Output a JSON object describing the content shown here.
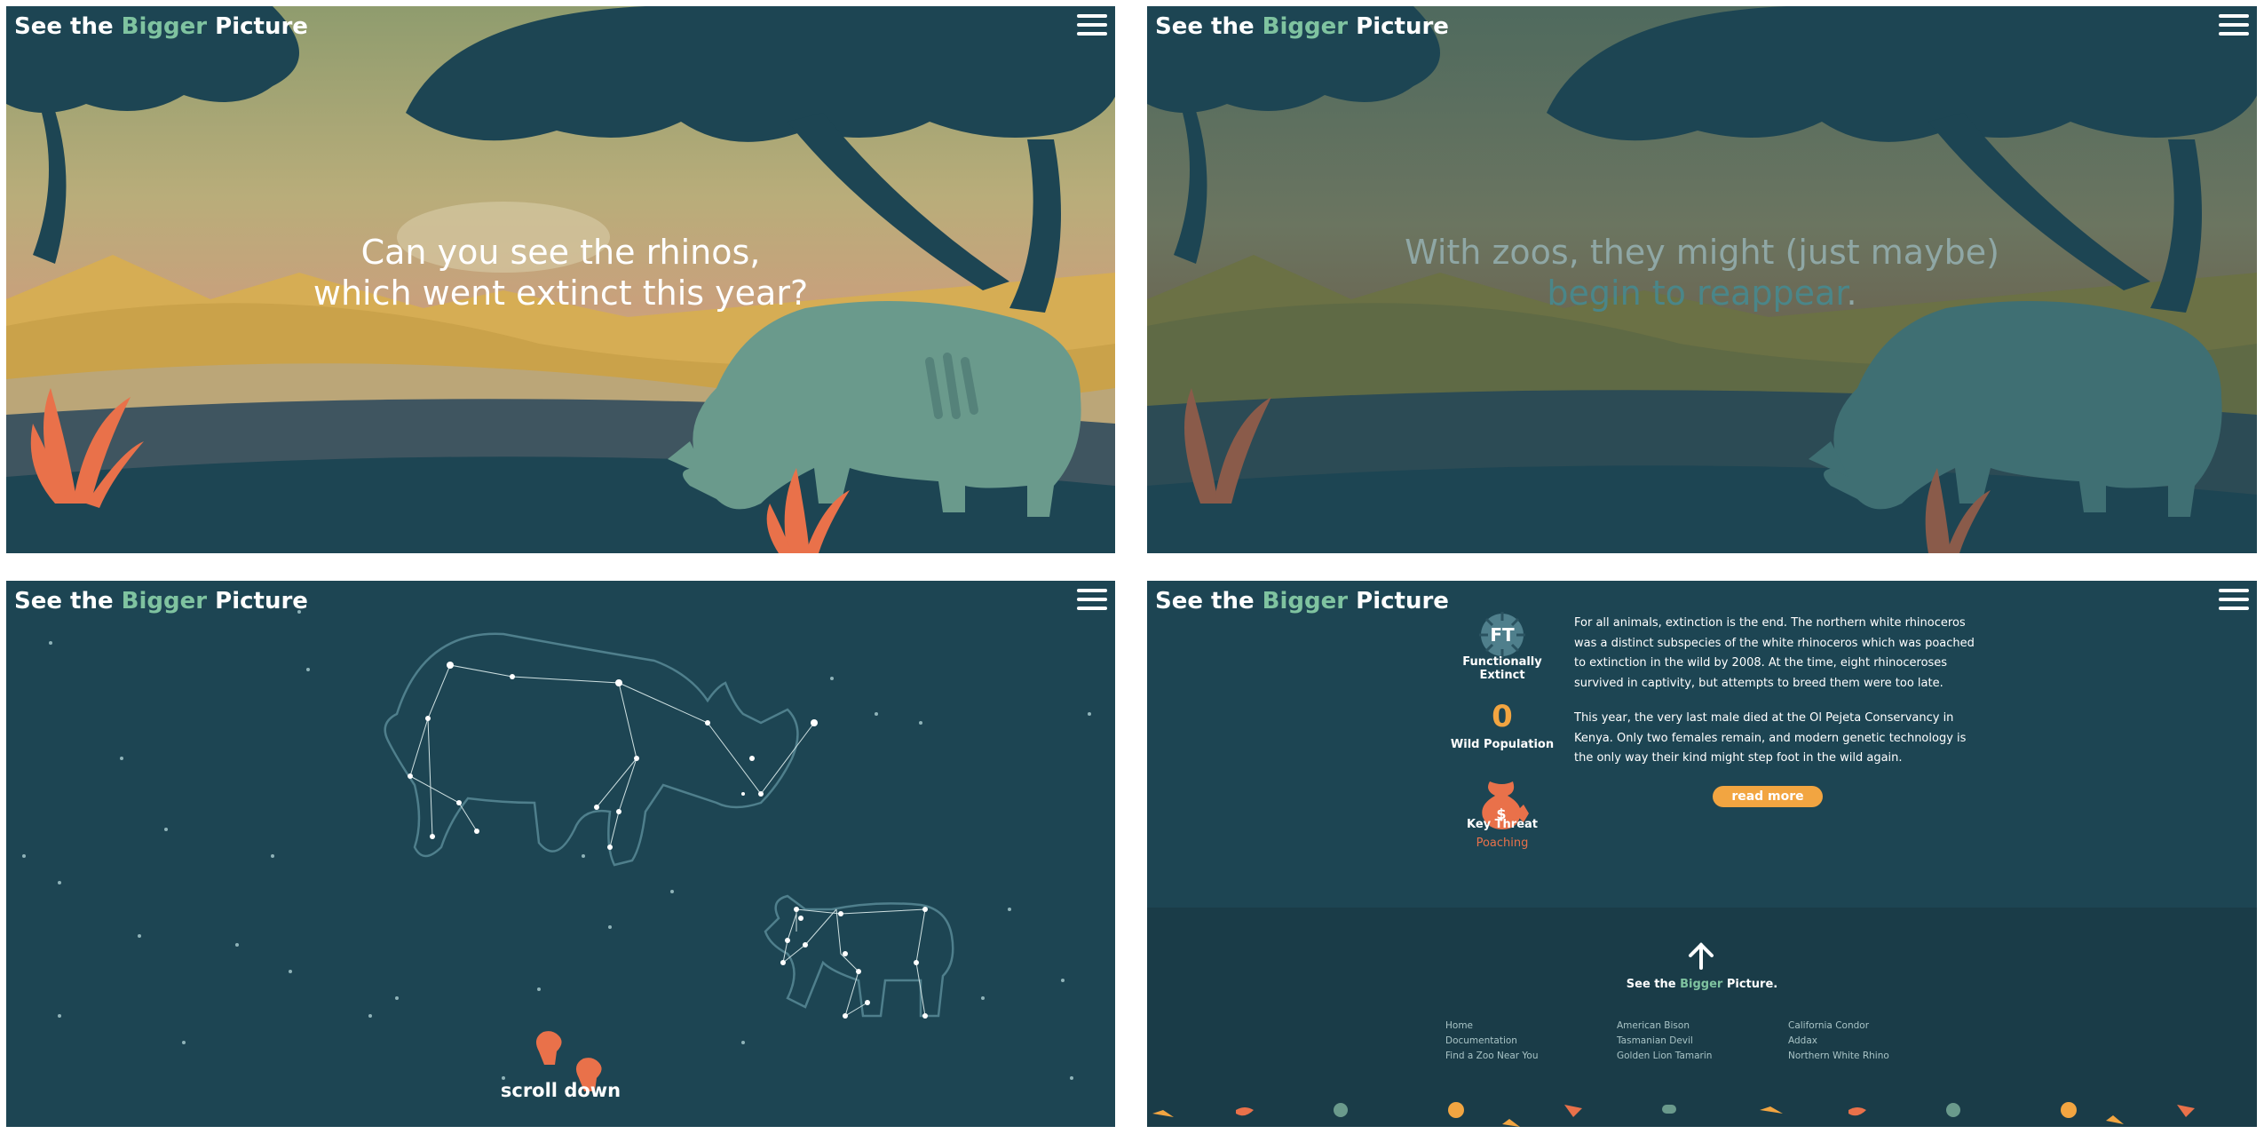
{
  "logo": {
    "prefix": "See the ",
    "accent": "Bigger",
    "suffix": " Picture"
  },
  "panel1": {
    "line1": "Can you see the rhinos,",
    "line2": "which went extinct this year?"
  },
  "panel2": {
    "line1": "With zoos, they might (just maybe)",
    "line2_teal": "begin to reappear",
    "line2_end": "."
  },
  "panel3": {
    "scroll_label": "scroll down"
  },
  "panel4": {
    "status_badge": "FT",
    "status_label": "Functionally Extinct",
    "population_value": "0",
    "population_label": "Wild Population",
    "threat_label": "Key Threat",
    "threat_value": "Poaching",
    "paragraph1": [
      "For all animals, extinction is the end. The northern white rhinoceros",
      "was a distinct subspecies of the white rhinoceros which was poached",
      "to extinction in the wild by 2008. At the time, eight rhinoceroses",
      "survived in captivity, but attempts to breed them were too late."
    ],
    "paragraph2": [
      "This year, the very last male died at the Ol Pejeta Conservancy in",
      "Kenya. Only two females remain, and modern genetic technology is",
      "the only way their kind might step foot in the wild again."
    ],
    "read_more": "read more",
    "footer_tagline": {
      "prefix": "See the ",
      "accent": "Bigger",
      "suffix": " Picture."
    },
    "footer_links": {
      "col1": [
        "Home",
        "Documentation",
        "Find a Zoo Near You"
      ],
      "col2": [
        "American Bison",
        "Tasmanian Devil",
        "Golden Lion Tamarin"
      ],
      "col3": [
        "California Condor",
        "Addax",
        "Northern White Rhino"
      ]
    }
  },
  "colors": {
    "background": "#1d4553",
    "accent_green": "#7fc3a0",
    "orange": "#f2a541",
    "coral": "#e9714a",
    "rhino": "#6a9a8c"
  },
  "icons": [
    "menu-icon",
    "ft-badge-icon",
    "money-bag-icon",
    "up-arrow-icon",
    "footprint-icon"
  ]
}
